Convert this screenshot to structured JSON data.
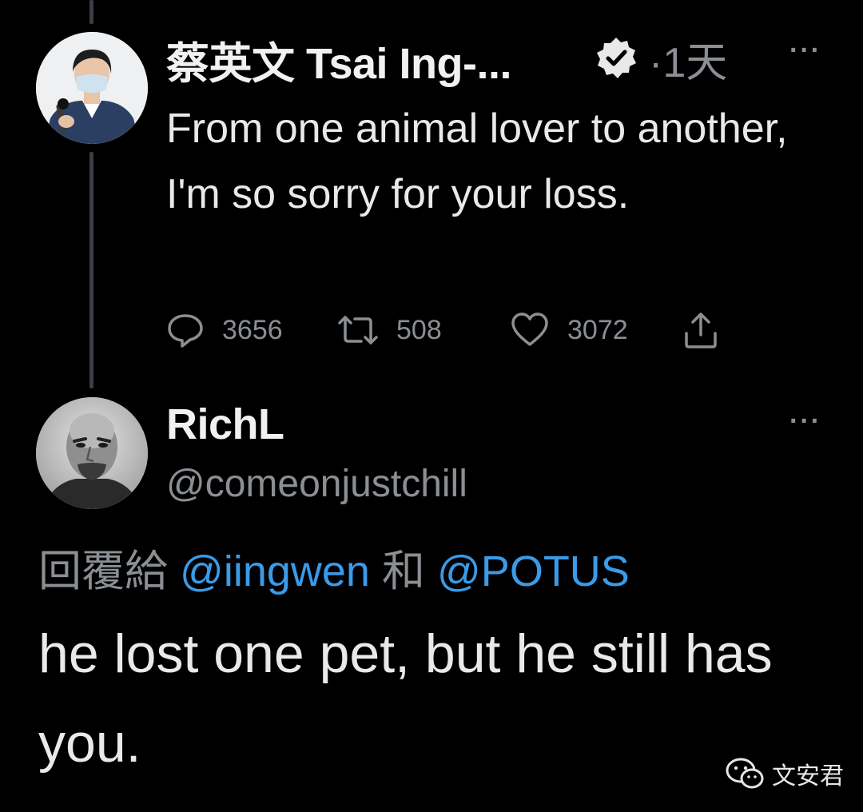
{
  "tweet": {
    "author_name": "蔡英文 Tsai Ing-...",
    "separator": "·",
    "time_ago": "1天",
    "more_label": "···",
    "text": "From one animal lover to another, I'm so sorry for your loss.",
    "stats": {
      "replies": "3656",
      "retweets": "508",
      "likes": "3072"
    }
  },
  "reply": {
    "author_name": "RichL",
    "handle": "@comeonjustchill",
    "more_label": "···",
    "reply_to_prefix": "回覆給",
    "mention_1": "@iingwen",
    "joiner": "和",
    "mention_2": "@POTUS",
    "text": "he lost one pet, but he still has you."
  },
  "watermark": {
    "text": "文安君"
  },
  "icons": {
    "verified": "verified-badge-icon",
    "reply": "speech-bubble-icon",
    "retweet": "retweet-icon",
    "like": "heart-icon",
    "share": "share-upload-icon",
    "more": "more-dots-icon",
    "watermark": "wechat-icon"
  },
  "colors": {
    "background": "#000000",
    "text": "#e7e9ea",
    "muted": "#8b8f94",
    "link": "#3a9be8",
    "thread_line": "#3a3f44"
  }
}
